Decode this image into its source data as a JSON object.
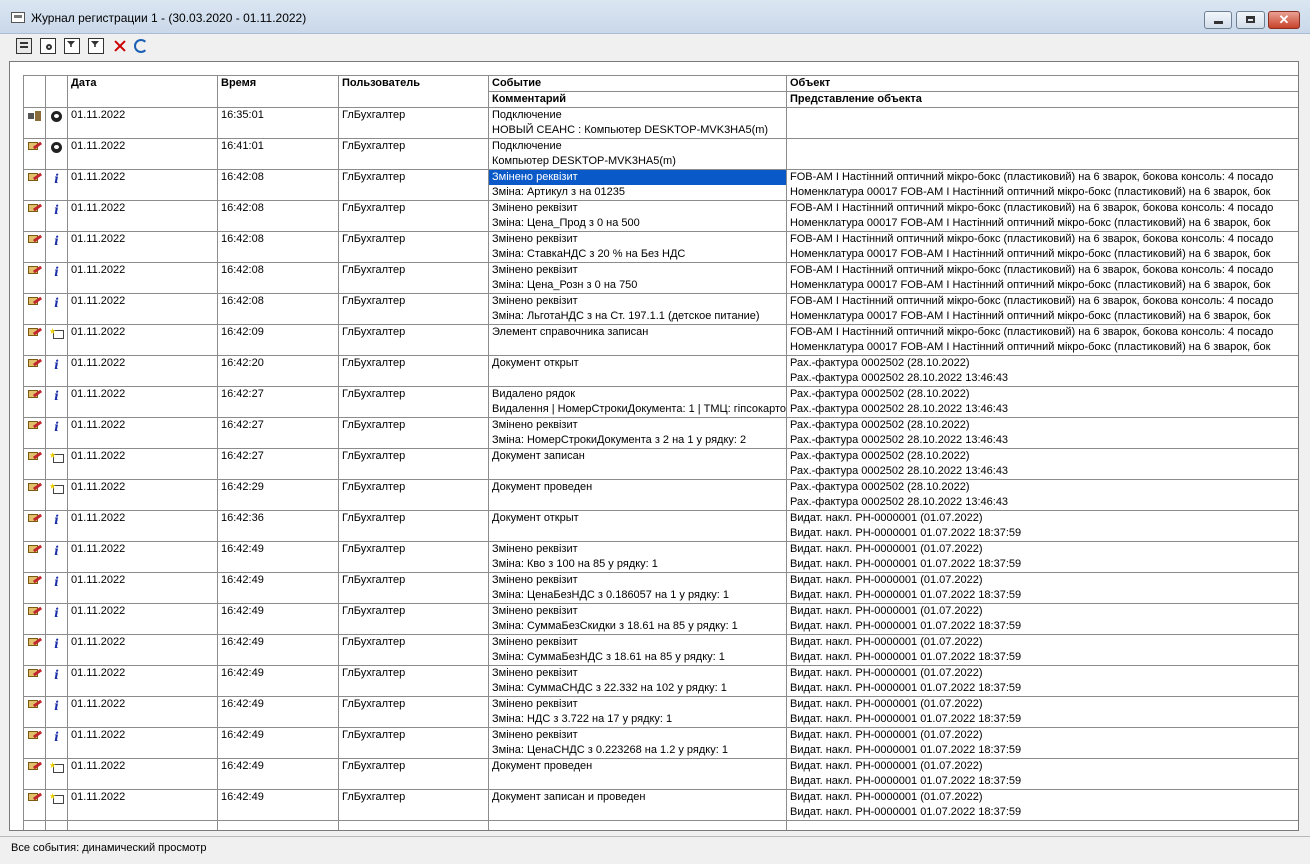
{
  "window": {
    "title": "Журнал регистрации 1 - (30.03.2020 - 01.11.2022)",
    "close_glyph": "✕"
  },
  "toolbar": {
    "icons": [
      "properties-icon",
      "preview-icon",
      "filter-icon",
      "filter-set-icon",
      "clear-filter-icon",
      "refresh-icon"
    ]
  },
  "columns": {
    "date": "Дата",
    "time": "Время",
    "user": "Пользователь",
    "event": "Событие",
    "comment": "Комментарий",
    "object": "Объект",
    "object_repr": "Представление объекта"
  },
  "rows": [
    {
      "ic1": "cable",
      "ic2": "person",
      "date": "01.11.2022",
      "time": "16:35:01",
      "user": "ГлБухгалтер",
      "event": "Подключение",
      "comment": "НОВЫЙ СЕАНС : Компьютер DESKTOP-MVK3HA5(m)",
      "object": "",
      "object2": ""
    },
    {
      "ic1": "pen",
      "ic2": "person",
      "date": "01.11.2022",
      "time": "16:41:01",
      "user": "ГлБухгалтер",
      "event": "Подключение",
      "comment": "Компьютер DESKTOP-MVK3HA5(m)",
      "object": "",
      "object2": ""
    },
    {
      "ic1": "pen",
      "ic2": "info",
      "date": "01.11.2022",
      "time": "16:42:08",
      "user": "ГлБухгалтер",
      "event": "Змінено реквізит",
      "comment": "Зміна: Артикул з  на 01235",
      "object": "FOB-AM I Настінний оптичний мікро-бокс (пластиковий) на 6 зварок, бокова консоль: 4 посадо",
      "object2": "Номенклатура 00017 FOB-AM I Настінний оптичний мікро-бокс (пластиковий) на 6 зварок, бок",
      "hl": true
    },
    {
      "ic1": "pen",
      "ic2": "info",
      "date": "01.11.2022",
      "time": "16:42:08",
      "user": "ГлБухгалтер",
      "event": "Змінено реквізит",
      "comment": "Зміна: Цена_Прод з 0 на 500",
      "object": "FOB-AM I Настінний оптичний мікро-бокс (пластиковий) на 6 зварок, бокова консоль: 4 посадо",
      "object2": "Номенклатура 00017 FOB-AM I Настінний оптичний мікро-бокс (пластиковий) на 6 зварок, бок"
    },
    {
      "ic1": "pen",
      "ic2": "info",
      "date": "01.11.2022",
      "time": "16:42:08",
      "user": "ГлБухгалтер",
      "event": "Змінено реквізит",
      "comment": "Зміна: СтавкаНДС з 20 % на Без НДС",
      "object": "FOB-AM I Настінний оптичний мікро-бокс (пластиковий) на 6 зварок, бокова консоль: 4 посадо",
      "object2": "Номенклатура 00017 FOB-AM I Настінний оптичний мікро-бокс (пластиковий) на 6 зварок, бок"
    },
    {
      "ic1": "pen",
      "ic2": "info",
      "date": "01.11.2022",
      "time": "16:42:08",
      "user": "ГлБухгалтер",
      "event": "Змінено реквізит",
      "comment": "Зміна: Цена_Розн з 0 на 750",
      "object": "FOB-AM I Настінний оптичний мікро-бокс (пластиковий) на 6 зварок, бокова консоль: 4 посадо",
      "object2": "Номенклатура 00017 FOB-AM I Настінний оптичний мікро-бокс (пластиковий) на 6 зварок, бок"
    },
    {
      "ic1": "pen",
      "ic2": "info",
      "date": "01.11.2022",
      "time": "16:42:08",
      "user": "ГлБухгалтер",
      "event": "Змінено реквізит",
      "comment": "Зміна: ЛьготаНДС з  на Ст. 197.1.1 (детское питание)",
      "object": "FOB-AM I Настінний оптичний мікро-бокс (пластиковий) на 6 зварок, бокова консоль: 4 посадо",
      "object2": "Номенклатура 00017 FOB-AM I Настінний оптичний мікро-бокс (пластиковий) на 6 зварок, бок"
    },
    {
      "ic1": "pen",
      "ic2": "doc",
      "date": "01.11.2022",
      "time": "16:42:09",
      "user": "ГлБухгалтер",
      "event": "Элемент справочника записан",
      "comment": "",
      "object": "FOB-AM I Настінний оптичний мікро-бокс (пластиковий) на 6 зварок, бокова консоль: 4 посадо",
      "object2": "Номенклатура 00017 FOB-AM I Настінний оптичний мікро-бокс (пластиковий) на 6 зварок, бок"
    },
    {
      "ic1": "pen",
      "ic2": "info",
      "date": "01.11.2022",
      "time": "16:42:20",
      "user": "ГлБухгалтер",
      "event": "Документ открыт",
      "comment": "",
      "object": "Рах.-фактура 0002502 (28.10.2022)",
      "object2": "Рах.-фактура 0002502 28.10.2022 13:46:43"
    },
    {
      "ic1": "pen",
      "ic2": "info",
      "date": "01.11.2022",
      "time": "16:42:27",
      "user": "ГлБухгалтер",
      "event": "Видалено рядок",
      "comment": "Видалення | НомерСтрокиДокумента: 1 | ТМЦ: гіпсокарто",
      "object": "Рах.-фактура 0002502 (28.10.2022)",
      "object2": "Рах.-фактура 0002502 28.10.2022 13:46:43"
    },
    {
      "ic1": "pen",
      "ic2": "info",
      "date": "01.11.2022",
      "time": "16:42:27",
      "user": "ГлБухгалтер",
      "event": "Змінено реквізит",
      "comment": "Зміна: НомерСтрокиДокумента з 2 на 1 у рядку: 2",
      "object": "Рах.-фактура 0002502 (28.10.2022)",
      "object2": "Рах.-фактура 0002502 28.10.2022 13:46:43"
    },
    {
      "ic1": "pen",
      "ic2": "doc",
      "date": "01.11.2022",
      "time": "16:42:27",
      "user": "ГлБухгалтер",
      "event": "Документ записан",
      "comment": "",
      "object": "Рах.-фактура 0002502 (28.10.2022)",
      "object2": "Рах.-фактура 0002502 28.10.2022 13:46:43"
    },
    {
      "ic1": "pen",
      "ic2": "doc",
      "date": "01.11.2022",
      "time": "16:42:29",
      "user": "ГлБухгалтер",
      "event": "Документ проведен",
      "comment": "",
      "object": "Рах.-фактура 0002502 (28.10.2022)",
      "object2": "Рах.-фактура 0002502 28.10.2022 13:46:43"
    },
    {
      "ic1": "pen",
      "ic2": "info",
      "date": "01.11.2022",
      "time": "16:42:36",
      "user": "ГлБухгалтер",
      "event": "Документ открыт",
      "comment": "",
      "object": "Видат. накл. РН-0000001 (01.07.2022)",
      "object2": "Видат. накл. РН-0000001 01.07.2022 18:37:59"
    },
    {
      "ic1": "pen",
      "ic2": "info",
      "date": "01.11.2022",
      "time": "16:42:49",
      "user": "ГлБухгалтер",
      "event": "Змінено реквізит",
      "comment": "Зміна: Кво з 100 на 85 у рядку: 1",
      "object": "Видат. накл. РН-0000001 (01.07.2022)",
      "object2": "Видат. накл. РН-0000001 01.07.2022 18:37:59"
    },
    {
      "ic1": "pen",
      "ic2": "info",
      "date": "01.11.2022",
      "time": "16:42:49",
      "user": "ГлБухгалтер",
      "event": "Змінено реквізит",
      "comment": "Зміна: ЦенаБезНДС з 0.186057 на 1 у рядку: 1",
      "object": "Видат. накл. РН-0000001 (01.07.2022)",
      "object2": "Видат. накл. РН-0000001 01.07.2022 18:37:59"
    },
    {
      "ic1": "pen",
      "ic2": "info",
      "date": "01.11.2022",
      "time": "16:42:49",
      "user": "ГлБухгалтер",
      "event": "Змінено реквізит",
      "comment": "Зміна: СуммаБезСкидки з 18.61 на 85 у рядку: 1",
      "object": "Видат. накл. РН-0000001 (01.07.2022)",
      "object2": "Видат. накл. РН-0000001 01.07.2022 18:37:59"
    },
    {
      "ic1": "pen",
      "ic2": "info",
      "date": "01.11.2022",
      "time": "16:42:49",
      "user": "ГлБухгалтер",
      "event": "Змінено реквізит",
      "comment": "Зміна: СуммаБезНДС з 18.61 на 85 у рядку: 1",
      "object": "Видат. накл. РН-0000001 (01.07.2022)",
      "object2": "Видат. накл. РН-0000001 01.07.2022 18:37:59"
    },
    {
      "ic1": "pen",
      "ic2": "info",
      "date": "01.11.2022",
      "time": "16:42:49",
      "user": "ГлБухгалтер",
      "event": "Змінено реквізит",
      "comment": "Зміна: СуммаСНДС з 22.332 на 102 у рядку: 1",
      "object": "Видат. накл. РН-0000001 (01.07.2022)",
      "object2": "Видат. накл. РН-0000001 01.07.2022 18:37:59"
    },
    {
      "ic1": "pen",
      "ic2": "info",
      "date": "01.11.2022",
      "time": "16:42:49",
      "user": "ГлБухгалтер",
      "event": "Змінено реквізит",
      "comment": "Зміна: НДС з 3.722 на 17 у рядку: 1",
      "object": "Видат. накл. РН-0000001 (01.07.2022)",
      "object2": "Видат. накл. РН-0000001 01.07.2022 18:37:59"
    },
    {
      "ic1": "pen",
      "ic2": "info",
      "date": "01.11.2022",
      "time": "16:42:49",
      "user": "ГлБухгалтер",
      "event": "Змінено реквізит",
      "comment": "Зміна: ЦенаСНДС з 0.223268 на 1.2 у рядку: 1",
      "object": "Видат. накл. РН-0000001 (01.07.2022)",
      "object2": "Видат. накл. РН-0000001 01.07.2022 18:37:59"
    },
    {
      "ic1": "pen",
      "ic2": "doc",
      "date": "01.11.2022",
      "time": "16:42:49",
      "user": "ГлБухгалтер",
      "event": "Документ проведен",
      "comment": "",
      "object": "Видат. накл. РН-0000001 (01.07.2022)",
      "object2": "Видат. накл. РН-0000001 01.07.2022 18:37:59"
    },
    {
      "ic1": "pen",
      "ic2": "doc",
      "date": "01.11.2022",
      "time": "16:42:49",
      "user": "ГлБухгалтер",
      "event": "Документ записан и проведен",
      "comment": "",
      "object": "Видат. накл. РН-0000001 (01.07.2022)",
      "object2": "Видат. накл. РН-0000001 01.07.2022 18:37:59"
    }
  ],
  "status": {
    "text": "Все события: динамический просмотр"
  }
}
